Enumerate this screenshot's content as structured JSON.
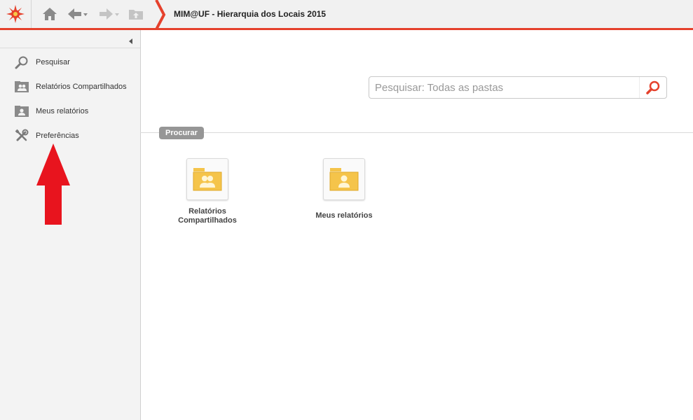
{
  "header": {
    "title": "MIM@UF - Hierarquia dos Locais 2015",
    "accent_color": "#e5412c",
    "icons": [
      "home-icon",
      "back-icon",
      "forward-icon",
      "folder-up-icon"
    ]
  },
  "sidebar": {
    "items": [
      {
        "label": "Pesquisar",
        "icon": "search-icon"
      },
      {
        "label": "Relatórios Compartilhados",
        "icon": "shared-folder-icon"
      },
      {
        "label": "Meus relatórios",
        "icon": "user-folder-icon"
      },
      {
        "label": "Preferências",
        "icon": "wrench-icon"
      }
    ]
  },
  "search": {
    "placeholder": "Pesquisar: Todas as pastas",
    "value": ""
  },
  "section": {
    "label": "Procurar"
  },
  "folders": [
    {
      "label_line1": "Relatórios",
      "label_line2": "Compartilhados",
      "icon": "shared-folder-icon"
    },
    {
      "label_line1": "Meus relatórios",
      "label_line2": "",
      "icon": "user-folder-icon"
    }
  ],
  "annotation": {
    "color": "#e8141e",
    "icon": "red-up-arrow"
  }
}
